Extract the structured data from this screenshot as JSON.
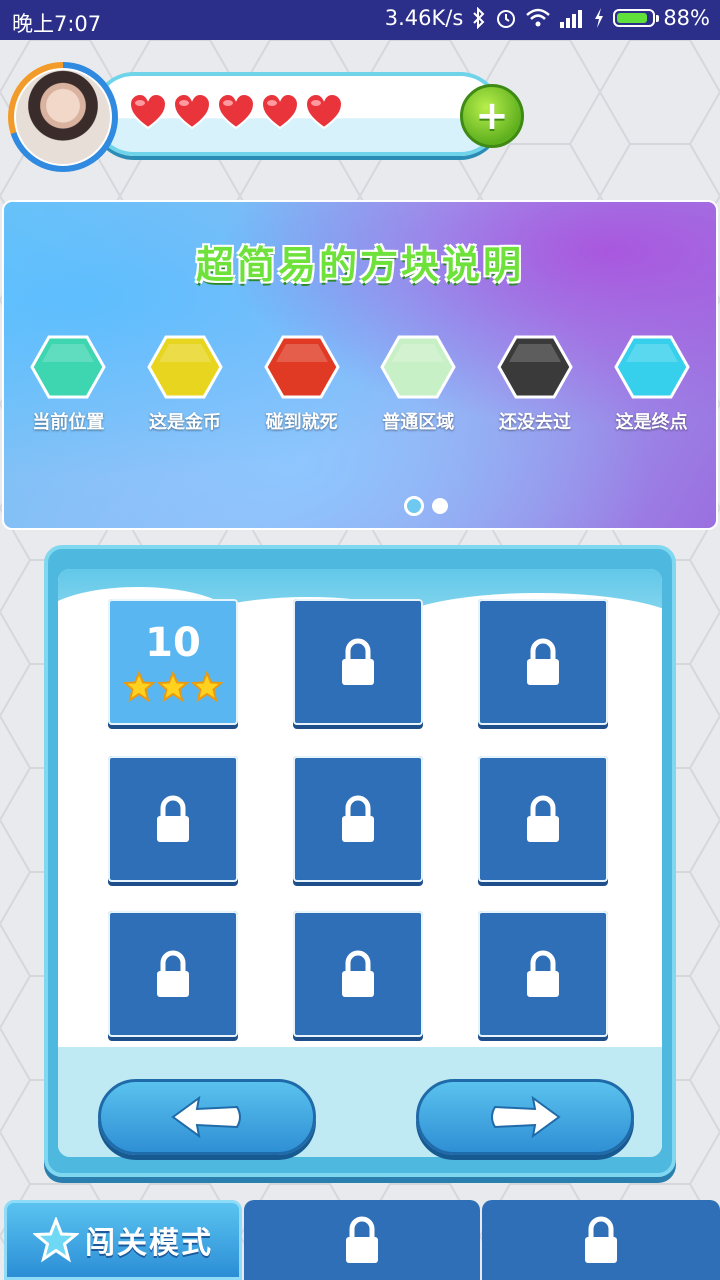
{
  "status_bar": {
    "time": "晚上7:07",
    "network_speed": "3.46K/s",
    "battery_percent": "88%",
    "battery_level": 0.88,
    "icons": [
      "bluetooth-icon",
      "alarm-icon",
      "wifi-icon",
      "signal-icon",
      "charging-icon",
      "battery-icon"
    ]
  },
  "header": {
    "avatar_icon": "user-avatar",
    "lives": 5,
    "hearts": [
      "heart-icon",
      "heart-icon",
      "heart-icon",
      "heart-icon",
      "heart-icon"
    ],
    "add_button_label": "+"
  },
  "banner": {
    "title": "超简易的方块说明",
    "legend": [
      {
        "label": "当前位置",
        "color": "#3dd6b0"
      },
      {
        "label": "这是金币",
        "color": "#e8d51f"
      },
      {
        "label": "碰到就死",
        "color": "#e03a24"
      },
      {
        "label": "普通区域",
        "color": "#c8f0c6"
      },
      {
        "label": "还没去过",
        "color": "#3a3a3a"
      },
      {
        "label": "这是终点",
        "color": "#36d0ec"
      }
    ],
    "page_indicator": {
      "pages": 2,
      "active": 0
    }
  },
  "levels": [
    {
      "number": "10",
      "locked": false,
      "stars": 3
    },
    {
      "locked": true
    },
    {
      "locked": true
    },
    {
      "locked": true
    },
    {
      "locked": true
    },
    {
      "locked": true
    },
    {
      "locked": true
    },
    {
      "locked": true
    },
    {
      "locked": true
    }
  ],
  "navigation": {
    "prev_icon": "arrow-left-icon",
    "next_icon": "arrow-right-icon"
  },
  "tabs": [
    {
      "label": "闯关模式",
      "icon": "star-icon",
      "active": true
    },
    {
      "icon": "lock-icon",
      "locked": true
    },
    {
      "icon": "lock-icon",
      "locked": true
    }
  ],
  "colors": {
    "status_bar": "#2b2f8a",
    "accent_blue": "#2f6fb7",
    "heart_red": "#e8343a",
    "title_green": "#6ee23b"
  }
}
